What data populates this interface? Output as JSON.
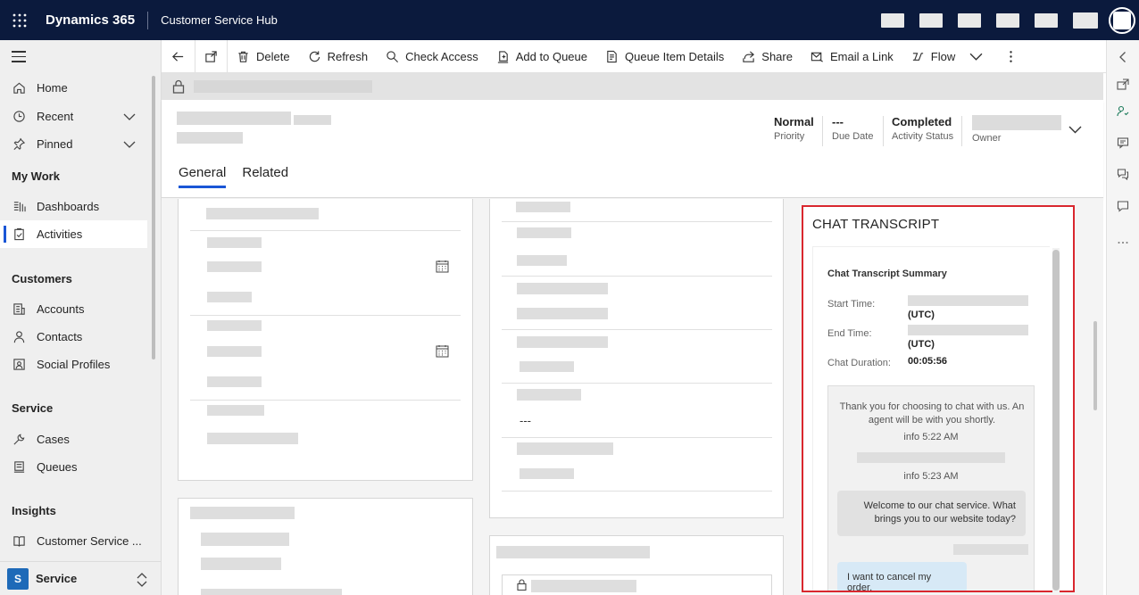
{
  "topbar": {
    "brand": "Dynamics 365",
    "app_name": "Customer Service Hub"
  },
  "nav": {
    "home": "Home",
    "recent": "Recent",
    "pinned": "Pinned",
    "my_work": "My Work",
    "dashboards": "Dashboards",
    "activities": "Activities",
    "customers": "Customers",
    "accounts": "Accounts",
    "contacts": "Contacts",
    "social_profiles": "Social Profiles",
    "service": "Service",
    "cases": "Cases",
    "queues": "Queues",
    "insights": "Insights",
    "customer_service": "Customer Service ...",
    "area_badge": "S",
    "area_label": "Service"
  },
  "commands": {
    "delete": "Delete",
    "refresh": "Refresh",
    "check_access": "Check Access",
    "add_to_queue": "Add to Queue",
    "queue_item_details": "Queue Item Details",
    "share": "Share",
    "email_link": "Email a Link",
    "flow": "Flow"
  },
  "header_fields": {
    "priority_value": "Normal",
    "priority_label": "Priority",
    "due_value": "---",
    "due_label": "Due Date",
    "status_value": "Completed",
    "status_label": "Activity Status",
    "owner_label": "Owner"
  },
  "tabs": {
    "general": "General",
    "related": "Related"
  },
  "form": {
    "middle_dash": "---"
  },
  "chat": {
    "title": "CHAT TRANSCRIPT",
    "summary_title": "Chat Transcript Summary",
    "start_label": "Start Time:",
    "start_tz": "(UTC)",
    "end_label": "End Time:",
    "end_tz": "(UTC)",
    "duration_label": "Chat Duration:",
    "duration_value": "00:05:56",
    "system_message": "Thank you for choosing to chat with us. An agent will be with you shortly.",
    "stamp1": "info 5:22 AM",
    "stamp2": "info 5:23 AM",
    "agent_message": "Welcome to our chat service. What brings you to our website today?",
    "user_message": "I want to cancel my order."
  }
}
